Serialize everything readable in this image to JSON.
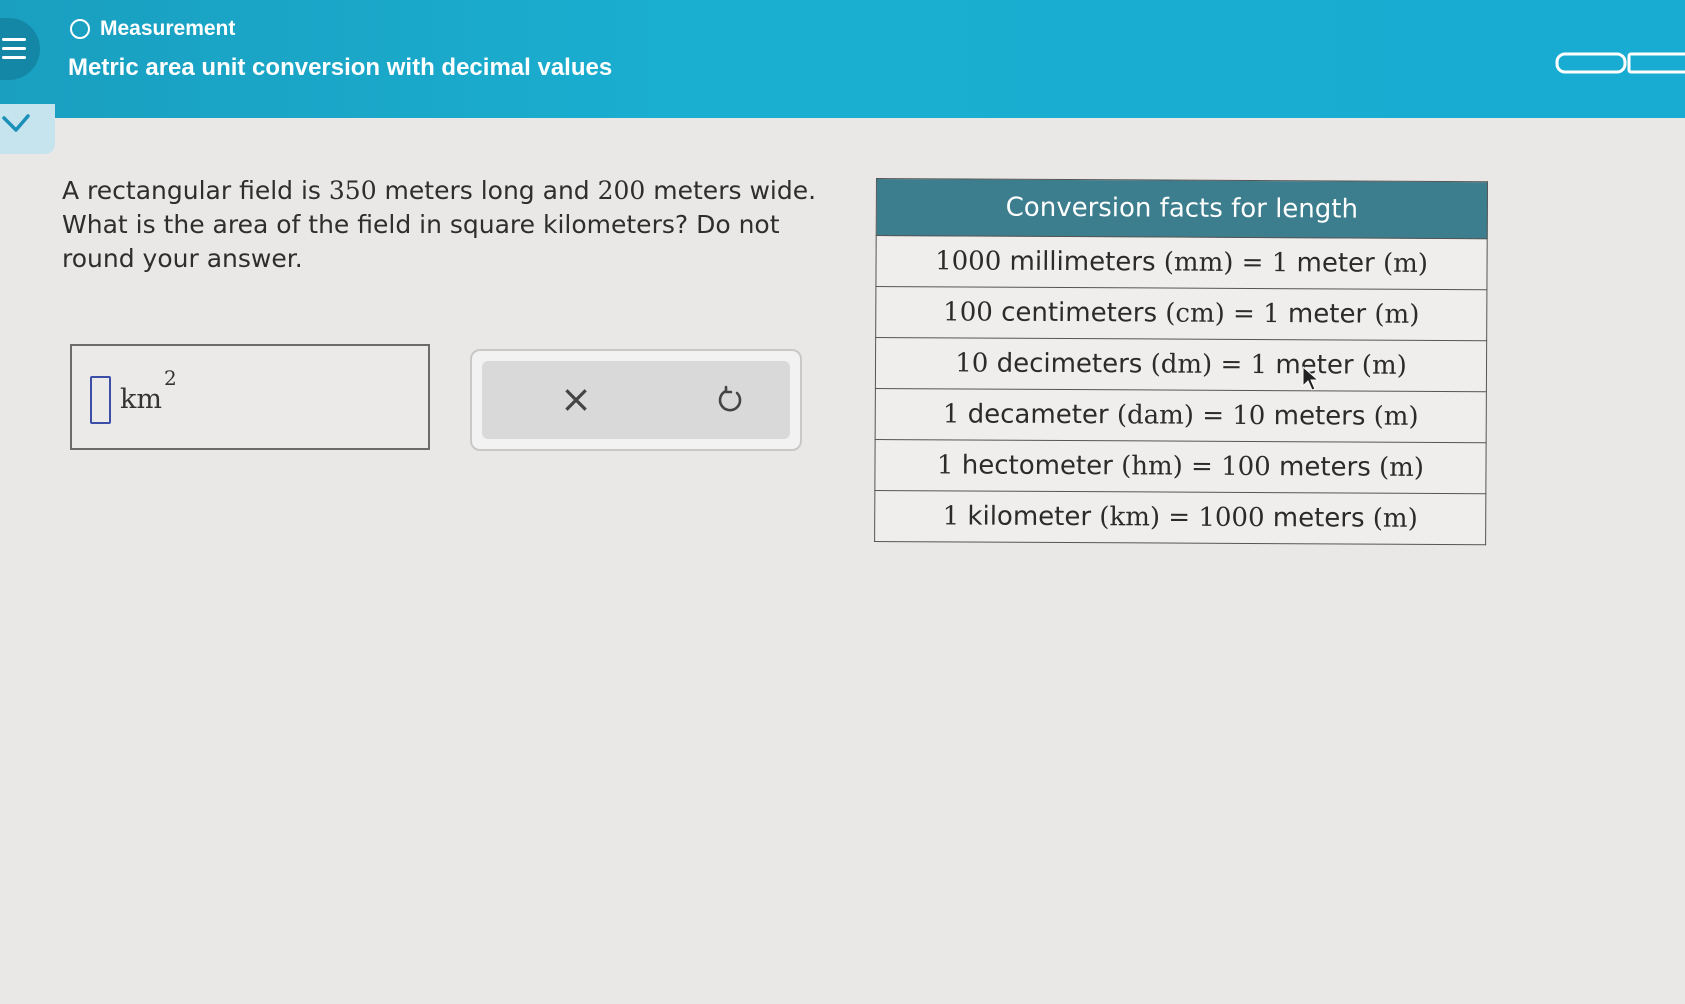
{
  "header": {
    "topic": "Measurement",
    "lesson_title": "Metric area unit conversion with decimal values"
  },
  "question": {
    "line1_a": "A rectangular field is ",
    "length": "350",
    "line1_b": " meters long and ",
    "width": "200",
    "line1_c": " meters wide.",
    "line2": "What is the area of the field in square kilometers? Do not",
    "line3": "round your answer."
  },
  "answer": {
    "value": "",
    "unit": "km",
    "unit_exponent": "2"
  },
  "buttons": {
    "clear_symbol": "×",
    "undo_icon": "undo-icon"
  },
  "conversion_table": {
    "title": "Conversion facts for length",
    "rows": [
      {
        "left_num": "1000",
        "left_word": " millimeters ",
        "left_abbr": "(mm)",
        "eq": " = ",
        "right_num": "1",
        "right_word": " meter ",
        "right_abbr": "(m)"
      },
      {
        "left_num": "100",
        "left_word": " centimeters ",
        "left_abbr": "(cm)",
        "eq": " = ",
        "right_num": "1",
        "right_word": " meter ",
        "right_abbr": "(m)"
      },
      {
        "left_num": "10",
        "left_word": " decimeters ",
        "left_abbr": "(dm)",
        "eq": " = ",
        "right_num": "1",
        "right_word": " meter ",
        "right_abbr": "(m)"
      },
      {
        "left_num": "1",
        "left_word": " decameter ",
        "left_abbr": "(dam)",
        "eq": " = ",
        "right_num": "10",
        "right_word": " meters ",
        "right_abbr": "(m)"
      },
      {
        "left_num": "1",
        "left_word": " hectometer ",
        "left_abbr": "(hm)",
        "eq": " = ",
        "right_num": "100",
        "right_word": " meters ",
        "right_abbr": "(m)"
      },
      {
        "left_num": "1",
        "left_word": " kilometer ",
        "left_abbr": "(km)",
        "eq": " = ",
        "right_num": "1000",
        "right_word": " meters ",
        "right_abbr": "(m)"
      }
    ]
  },
  "colors": {
    "header": "#1aaed0",
    "table_header": "#3c7e8e",
    "input_border": "#3b4fa6"
  }
}
